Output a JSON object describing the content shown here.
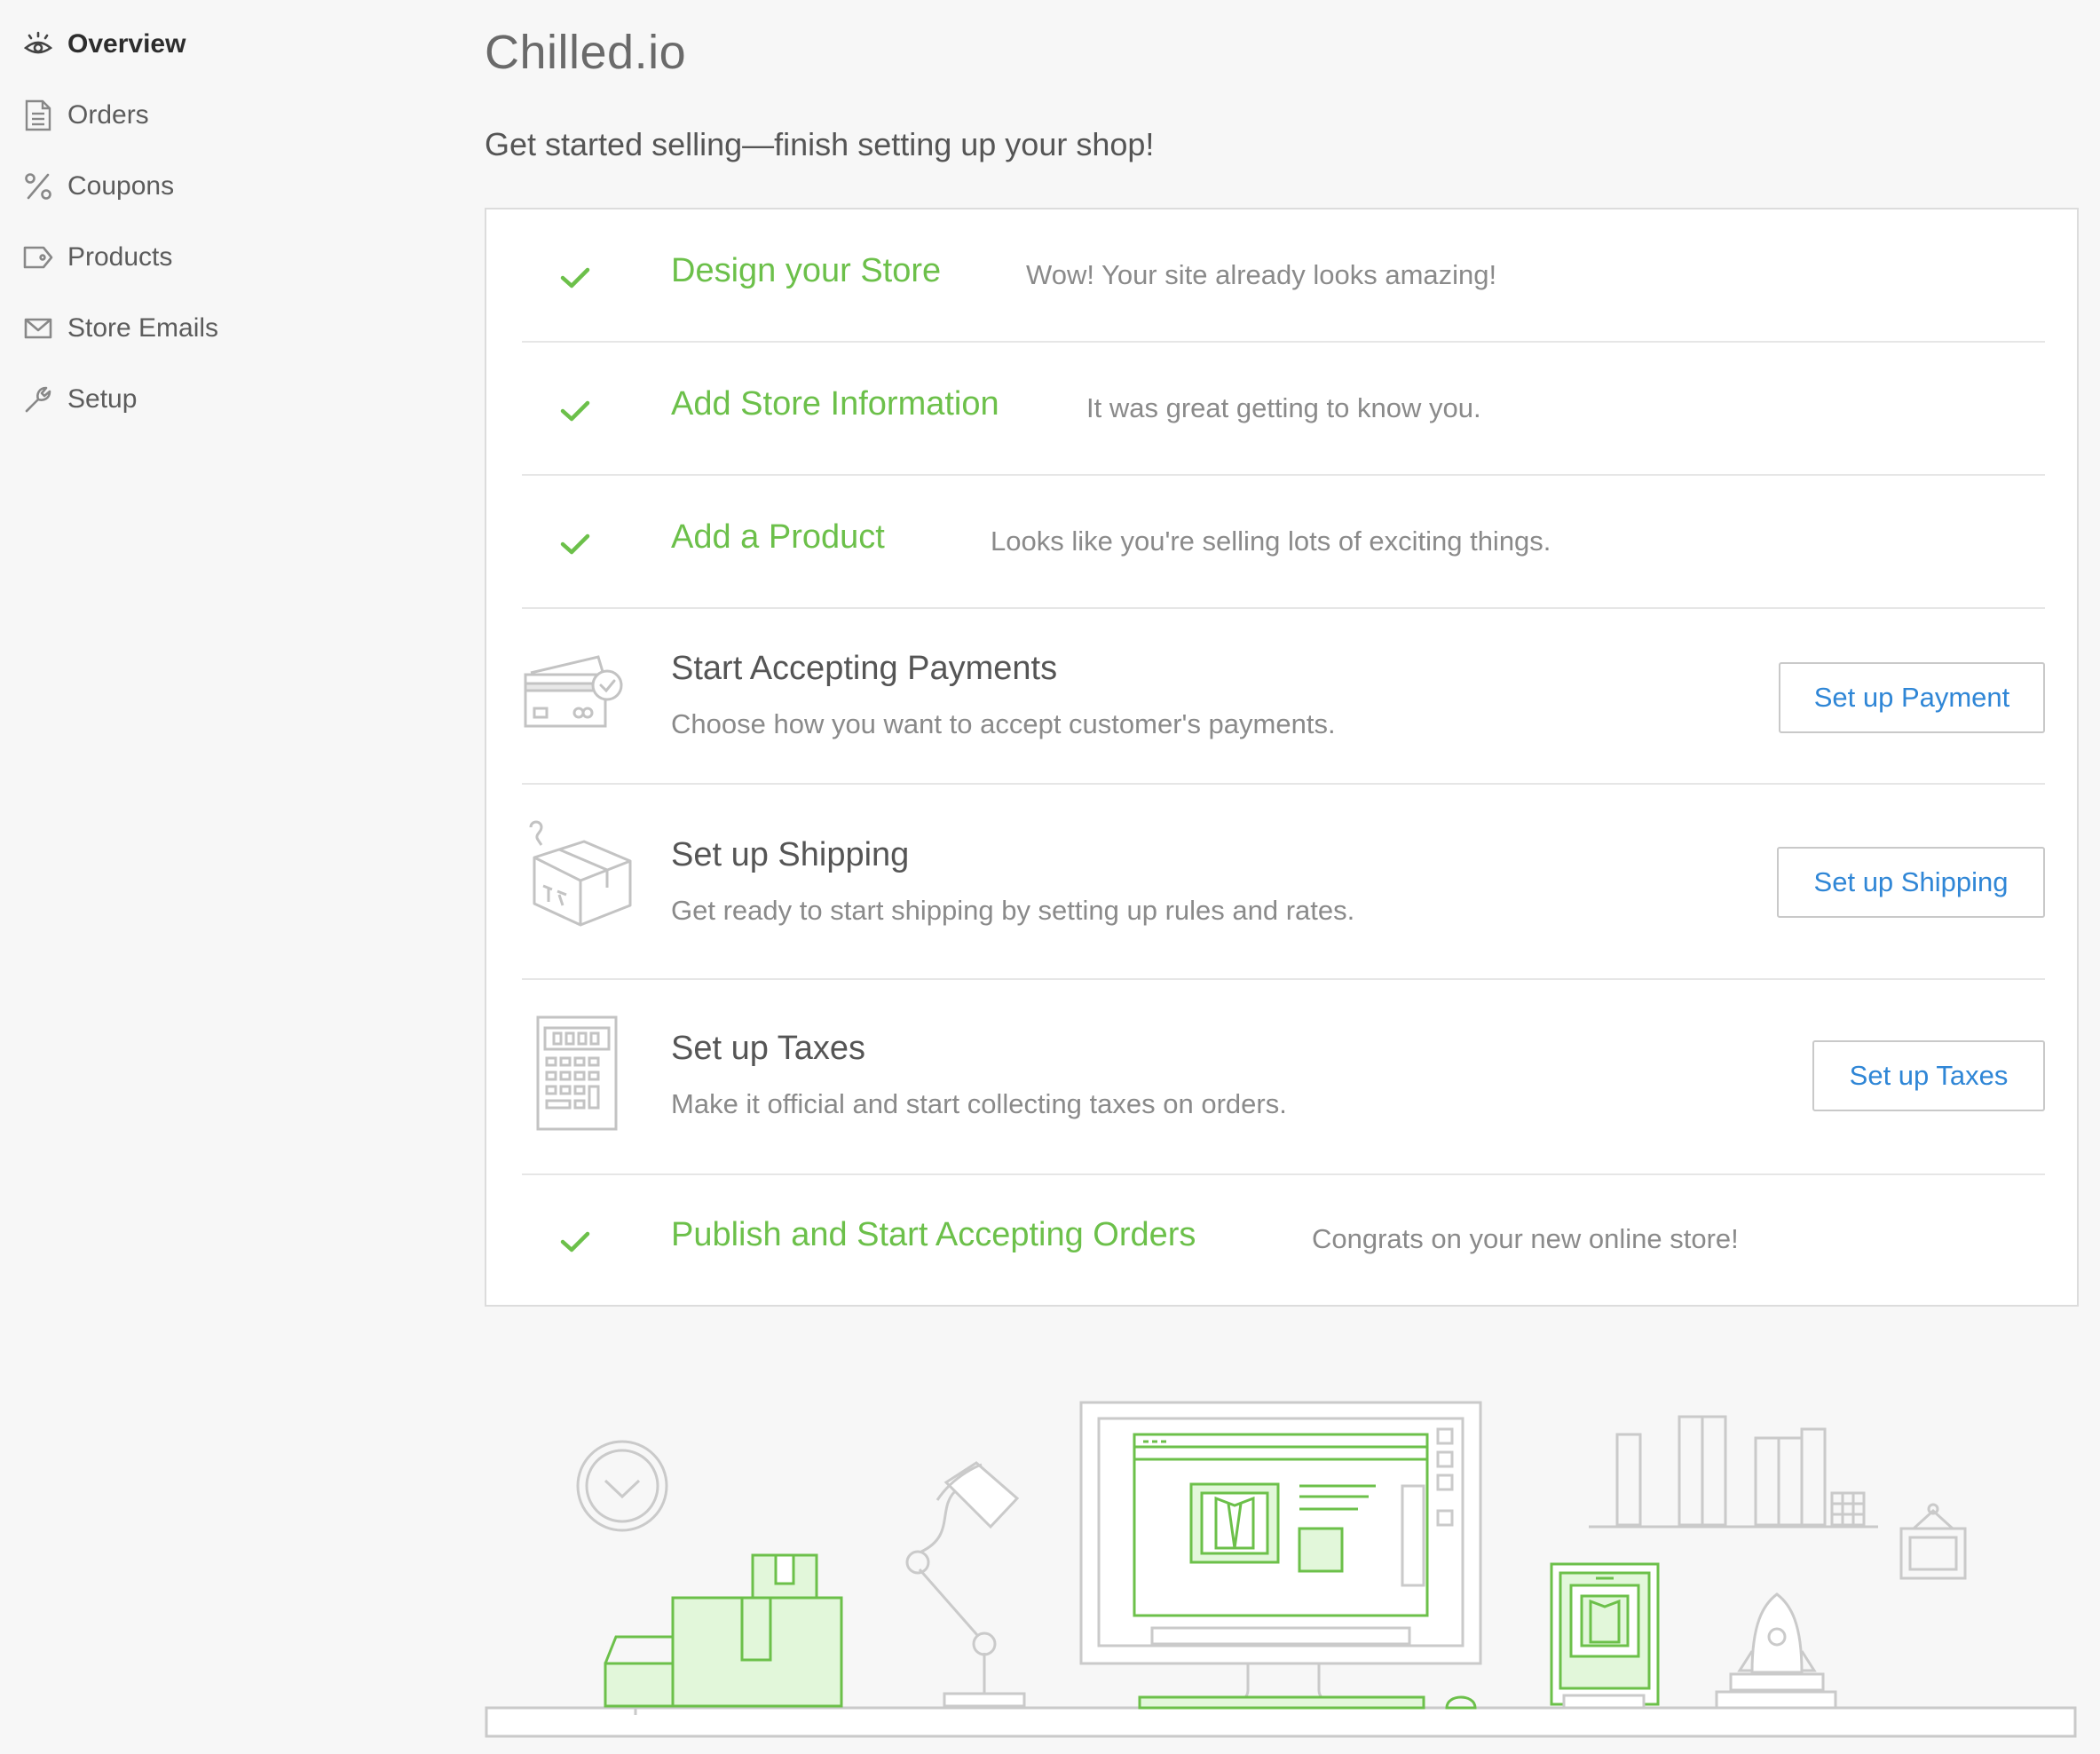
{
  "sidebar": {
    "items": [
      {
        "label": "Overview",
        "icon": "eye-icon",
        "active": true
      },
      {
        "label": "Orders",
        "icon": "document-icon"
      },
      {
        "label": "Coupons",
        "icon": "percent-icon"
      },
      {
        "label": "Products",
        "icon": "tag-icon"
      },
      {
        "label": "Store Emails",
        "icon": "envelope-icon"
      },
      {
        "label": "Setup",
        "icon": "wrench-icon"
      }
    ]
  },
  "header": {
    "shop_name": "Chilled.io",
    "subtitle": "Get started selling—finish setting up your shop!"
  },
  "steps": [
    {
      "title": "Design your Store",
      "note": "Wow! Your site already looks amazing!",
      "status": "complete"
    },
    {
      "title": "Add Store Information",
      "note": "It was great getting to know you.",
      "status": "complete"
    },
    {
      "title": "Add a Product",
      "note": "Looks like you're selling lots of exciting things.",
      "status": "complete"
    },
    {
      "title": "Start Accepting Payments",
      "note": "Choose how you want to accept customer's payments.",
      "status": "pending",
      "button": "Set up Payment",
      "icon": "credit-card-icon"
    },
    {
      "title": "Set up Shipping",
      "note": "Get ready to start shipping by setting up rules and rates.",
      "status": "pending",
      "button": "Set up Shipping",
      "icon": "shipping-box-icon"
    },
    {
      "title": "Set up Taxes",
      "note": "Make it official and start collecting taxes on orders.",
      "status": "pending",
      "button": "Set up Taxes",
      "icon": "calculator-icon"
    },
    {
      "title": "Publish and Start Accepting Orders",
      "note": "Congrats on your new online store!",
      "status": "complete"
    }
  ],
  "colors": {
    "complete_green": "#6cc04a",
    "link_blue": "#2f86d6",
    "illustration_gray": "#c8c8c8",
    "illustration_fill_green": "#e2f7da"
  }
}
